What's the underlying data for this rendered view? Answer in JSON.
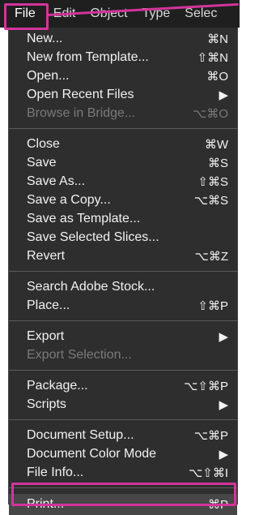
{
  "menubar": {
    "items": [
      "File",
      "Edit",
      "Object",
      "Type",
      "Selec"
    ]
  },
  "menu": {
    "group1": [
      {
        "label": "New...",
        "shortcut": "⌘N",
        "disabled": false
      },
      {
        "label": "New from Template...",
        "shortcut": "⇧⌘N",
        "disabled": false
      },
      {
        "label": "Open...",
        "shortcut": "⌘O",
        "disabled": false
      },
      {
        "label": "Open Recent Files",
        "shortcut": "▶",
        "disabled": false
      },
      {
        "label": "Browse in Bridge...",
        "shortcut": "⌥⌘O",
        "disabled": true
      }
    ],
    "group2": [
      {
        "label": "Close",
        "shortcut": "⌘W",
        "disabled": false
      },
      {
        "label": "Save",
        "shortcut": "⌘S",
        "disabled": false
      },
      {
        "label": "Save As...",
        "shortcut": "⇧⌘S",
        "disabled": false
      },
      {
        "label": "Save a Copy...",
        "shortcut": "⌥⌘S",
        "disabled": false
      },
      {
        "label": "Save as Template...",
        "shortcut": "",
        "disabled": false
      },
      {
        "label": "Save Selected Slices...",
        "shortcut": "",
        "disabled": false
      },
      {
        "label": "Revert",
        "shortcut": "⌥⌘Z",
        "disabled": false
      }
    ],
    "group3": [
      {
        "label": "Search Adobe Stock...",
        "shortcut": "",
        "disabled": false
      },
      {
        "label": "Place...",
        "shortcut": "⇧⌘P",
        "disabled": false
      }
    ],
    "group4": [
      {
        "label": "Export",
        "shortcut": "▶",
        "disabled": false
      },
      {
        "label": "Export Selection...",
        "shortcut": "",
        "disabled": true
      }
    ],
    "group5": [
      {
        "label": "Package...",
        "shortcut": "⌥⇧⌘P",
        "disabled": false
      },
      {
        "label": "Scripts",
        "shortcut": "▶",
        "disabled": false
      }
    ],
    "group6": [
      {
        "label": "Document Setup...",
        "shortcut": "⌥⌘P",
        "disabled": false
      },
      {
        "label": "Document Color Mode",
        "shortcut": "▶",
        "disabled": false
      },
      {
        "label": "File Info...",
        "shortcut": "⌥⇧⌘I",
        "disabled": false
      }
    ],
    "group7": [
      {
        "label": "Print...",
        "shortcut": "⌘P",
        "disabled": false
      }
    ]
  },
  "colors": {
    "highlight": "#d3349a",
    "menu_bg": "#2e2e2e",
    "menubar_bg": "#1f1f1f"
  }
}
